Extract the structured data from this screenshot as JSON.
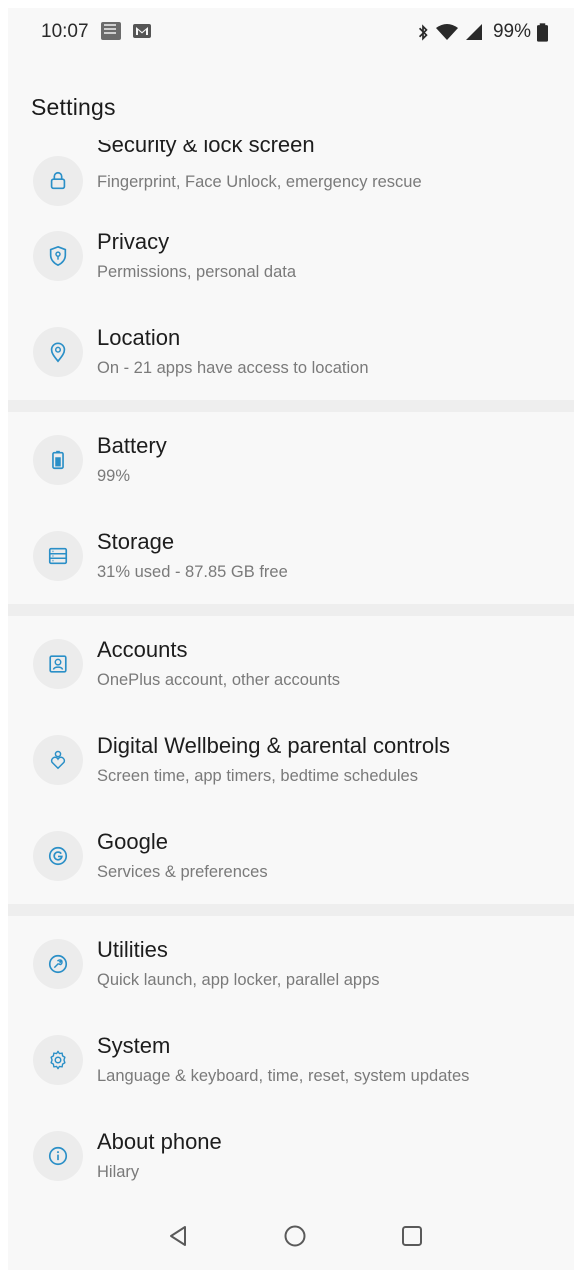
{
  "status_bar": {
    "time": "10:07",
    "battery": "99%"
  },
  "header": {
    "title": "Settings"
  },
  "colors": {
    "accent": "#2a8fc7",
    "icon_bg": "#ececec",
    "divider": "#eeeeee"
  },
  "items": [
    {
      "title": "Security & lock screen",
      "subtitle": "Fingerprint, Face Unlock, emergency rescue",
      "icon": "lock-icon"
    },
    {
      "title": "Privacy",
      "subtitle": "Permissions, personal data",
      "icon": "shield-icon"
    },
    {
      "title": "Location",
      "subtitle": "On - 21 apps have access to location",
      "icon": "location-pin-icon"
    },
    {
      "title": "Battery",
      "subtitle": "99%",
      "icon": "battery-icon"
    },
    {
      "title": "Storage",
      "subtitle": "31% used - 87.85 GB free",
      "icon": "storage-icon"
    },
    {
      "title": "Accounts",
      "subtitle": "OnePlus account, other accounts",
      "icon": "account-icon"
    },
    {
      "title": "Digital Wellbeing & parental controls",
      "subtitle": "Screen time, app timers, bedtime schedules",
      "icon": "wellbeing-icon"
    },
    {
      "title": "Google",
      "subtitle": "Services & preferences",
      "icon": "google-icon"
    },
    {
      "title": "Utilities",
      "subtitle": "Quick launch, app locker, parallel apps",
      "icon": "utilities-icon"
    },
    {
      "title": "System",
      "subtitle": "Language & keyboard, time, reset, system updates",
      "icon": "gear-icon"
    },
    {
      "title": "About phone",
      "subtitle": "Hilary",
      "icon": "info-icon"
    }
  ]
}
